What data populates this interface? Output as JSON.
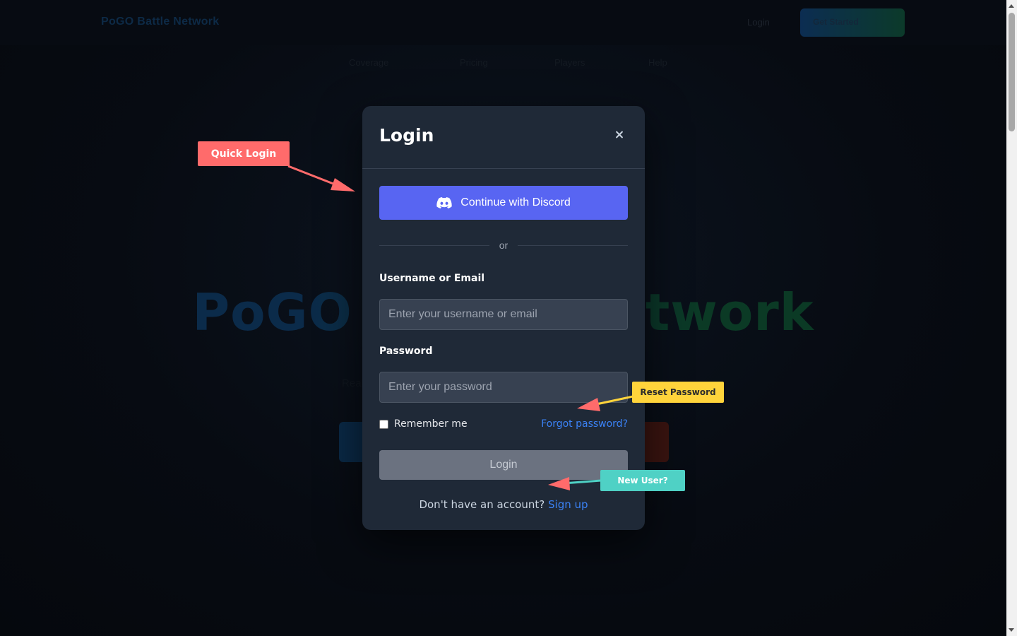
{
  "background": {
    "brand": "PoGO Battle Network",
    "login_link": "Login",
    "cta_button": "Get Started",
    "nav": [
      "Coverage",
      "Pricing",
      "Players",
      "Help"
    ],
    "hero_title": "PoGO Battle Network",
    "hero_subtitle": "Real-time Battle League tracking, ratings, and community for trainers"
  },
  "modal": {
    "title": "Login",
    "close_label": "×",
    "discord_button": "Continue with Discord",
    "divider_text": "or",
    "username": {
      "label": "Username or Email",
      "placeholder": "Enter your username or email",
      "value": ""
    },
    "password": {
      "label": "Password",
      "placeholder": "Enter your password",
      "value": ""
    },
    "remember_me": "Remember me",
    "remember_checked": false,
    "forgot_password": "Forgot password?",
    "login_button": "Login",
    "signup_prompt": "Don't have an account?",
    "signup_link": "Sign up"
  },
  "annotations": {
    "quick_login": "Quick Login",
    "reset_password": "Reset Password",
    "new_user": "New User?"
  },
  "colors": {
    "modal_bg": "#1f2937",
    "discord": "#5865f2",
    "link": "#3b82f6",
    "login_button": "#6b7280",
    "tag_quick": "#ff6b6b",
    "tag_reset": "#ffd43b",
    "tag_new": "#4fd1c5"
  },
  "icons": {
    "discord": "discord-icon",
    "close": "close-icon",
    "checkbox": "checkbox-icon"
  }
}
